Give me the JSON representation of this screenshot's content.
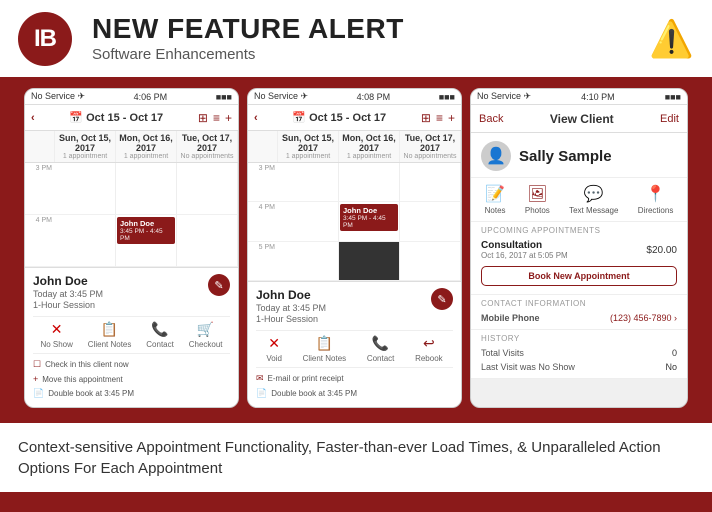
{
  "header": {
    "logo_letters": "IB",
    "main_title": "NEW FEATURE ALERT",
    "subtitle": "Software Enhancements",
    "alert_icon": "⚠"
  },
  "phones": [
    {
      "id": "phone1",
      "status_bar": {
        "left": "No Service ✈",
        "center": "4:06 PM",
        "right": "🔋"
      },
      "nav_title": "Oct 15 - Oct 17",
      "cal_days": [
        {
          "day": "Sun, Oct 15, 2017",
          "appts": "1 appointment"
        },
        {
          "day": "Mon, Oct 16, 2017",
          "appts": "1 appointment"
        },
        {
          "day": "Tue, Oct 17, 2017",
          "appts": "No appointments"
        }
      ],
      "times": [
        "3 PM",
        "4 PM"
      ],
      "event": {
        "name": "John Doe",
        "time": "3:45 PM - 4:45 PM",
        "service": "1-Hour Session"
      },
      "popup": {
        "name": "John Doe",
        "time_detail": "Today at 3:45 PM",
        "service": "1-Hour Session",
        "actions": [
          "No Show",
          "Client Notes",
          "Contact",
          "Checkout"
        ],
        "options": [
          "Check in this client now",
          "Move this appointment",
          "Double book at 3:45 PM"
        ]
      }
    },
    {
      "id": "phone2",
      "status_bar": {
        "left": "No Service ✈",
        "center": "4:08 PM",
        "right": "🔋"
      },
      "nav_title": "Oct 15 - Oct 17",
      "cal_days": [
        {
          "day": "Sun, Oct 15, 2017",
          "appts": "1 appointment"
        },
        {
          "day": "Mon, Oct 16, 2017",
          "appts": "1 appointment"
        },
        {
          "day": "Tue, Oct 17, 2017",
          "appts": "No appointments"
        }
      ],
      "times": [
        "3 PM",
        "4 PM",
        "5 PM"
      ],
      "event": {
        "name": "John Doe",
        "time": "3:45 PM - 4:45 PM",
        "service": "1-Hour Session"
      },
      "popup": {
        "name": "John Doe",
        "time_detail": "Today at 3:45 PM",
        "service": "1-Hour Session",
        "actions": [
          "Void",
          "Client Notes",
          "Contact",
          "Rebook"
        ],
        "options": [
          "E-mail or print receipt",
          "Double book at 3:45 PM"
        ]
      }
    }
  ],
  "client_view": {
    "status_bar": {
      "left": "No Service ✈",
      "center": "4:10 PM",
      "right": "🔋"
    },
    "nav": {
      "back": "Back",
      "title": "View Client",
      "edit": "Edit"
    },
    "client_name": "Sally Sample",
    "quick_actions": [
      "Notes",
      "Photos",
      "Text Message",
      "Directions"
    ],
    "upcoming_section": "UPCOMING APPOINTMENTS",
    "appointment": {
      "name": "Consultation",
      "price": "$20.00",
      "date": "Oct 16, 2017 at 5:05 PM"
    },
    "book_button": "Book New Appointment",
    "contact_section": "CONTACT INFORMATION",
    "contact": {
      "label": "Mobile Phone",
      "value": "(123) 456-7890 ›"
    },
    "history_section": "HISTORY",
    "history": [
      {
        "label": "Total Visits",
        "value": "0"
      },
      {
        "label": "Last Visit was No Show",
        "value": "No"
      }
    ]
  },
  "footer": {
    "text": "Context-sensitive Appointment Functionality, Faster-than-ever Load Times, & Unparalleled Action Options For Each Appointment"
  }
}
